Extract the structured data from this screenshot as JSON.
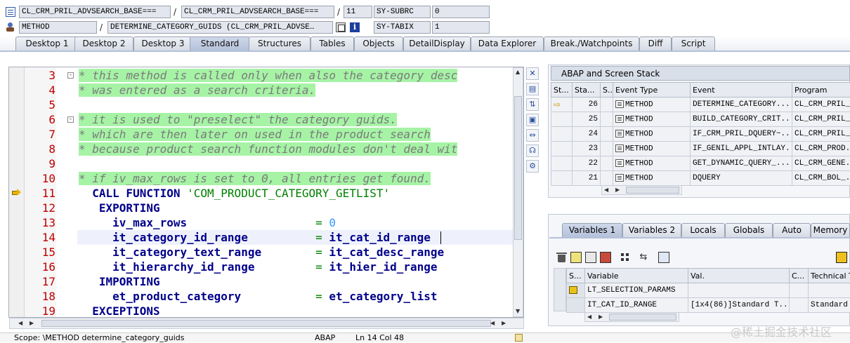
{
  "header": {
    "row1": {
      "program": "CL_CRM_PRIL_ADVSEARCH_BASE===",
      "include": "CL_CRM_PRIL_ADVSEARCH_BASE===",
      "line": "11",
      "sysvar_name": "SY-SUBRC",
      "sysvar_value": "0"
    },
    "row2": {
      "event_type": "METHOD",
      "event": "DETERMINE_CATEGORY_GUIDS (CL_CRM_PRIL_ADVSE…",
      "sysvar_name": "SY-TABIX",
      "sysvar_value": "1"
    },
    "separator": "/"
  },
  "tabs": [
    {
      "label": "Desktop 1"
    },
    {
      "label": "Desktop 2"
    },
    {
      "label": "Desktop 3"
    },
    {
      "label": "Standard",
      "active": true
    },
    {
      "label": "Structures"
    },
    {
      "label": "Tables"
    },
    {
      "label": "Objects"
    },
    {
      "label": "DetailDisplay"
    },
    {
      "label": "Data Explorer"
    },
    {
      "label": "Break./Watchpoints"
    },
    {
      "label": "Diff"
    },
    {
      "label": "Script"
    }
  ],
  "code": {
    "lines": [
      {
        "n": "3",
        "text": "* this method is called only when also the category desc",
        "type": "comment",
        "fold": "-"
      },
      {
        "n": "4",
        "text": "* was entered as a search criteria.",
        "type": "comment"
      },
      {
        "n": "5",
        "text": "",
        "type": "blank"
      },
      {
        "n": "6",
        "text": "* it is used to \"preselect\" the category guids.",
        "type": "comment",
        "fold": "-"
      },
      {
        "n": "7",
        "text": "* which are then later on used in the product search",
        "type": "comment"
      },
      {
        "n": "8",
        "text": "* because product search function modules don't deal wit",
        "type": "comment"
      },
      {
        "n": "9",
        "text": "",
        "type": "blank"
      },
      {
        "n": "10",
        "text": "* if iv_max_rows is set to 0, all entries get found.",
        "type": "comment"
      },
      {
        "n": "11",
        "kw": "  CALL FUNCTION ",
        "str": "'COM_PRODUCT_CATEGORY_GETLIST'",
        "type": "call"
      },
      {
        "n": "12",
        "kw": "   EXPORTING",
        "type": "kwline"
      },
      {
        "n": "13",
        "param": "     iv_max_rows                   ",
        "eq": "= ",
        "num": "0",
        "type": "assign_num"
      },
      {
        "n": "14",
        "param": "     it_category_id_range          ",
        "eq": "= ",
        "val": "it_cat_id_range",
        "type": "assign"
      },
      {
        "n": "15",
        "param": "     it_category_text_range        ",
        "eq": "= ",
        "val": "it_cat_desc_range",
        "type": "assign"
      },
      {
        "n": "16",
        "param": "     it_hierarchy_id_range         ",
        "eq": "= ",
        "val": "it_hier_id_range",
        "type": "assign"
      },
      {
        "n": "17",
        "kw": "   IMPORTING",
        "type": "kwline"
      },
      {
        "n": "18",
        "param": "     et_product_category           ",
        "eq": "= ",
        "val": "et_category_list",
        "type": "assign"
      },
      {
        "n": "19",
        "kw": "  EXCEPTIONS",
        "type": "kwline"
      }
    ]
  },
  "status": {
    "scope": "Scope: \\METHOD determine_category_guids",
    "language": "ABAP",
    "position": "Ln  14 Col  48"
  },
  "stack": {
    "title": "ABAP and Screen Stack",
    "columns": [
      "St...",
      "Sta...",
      "S...",
      "Event Type",
      "Event",
      "Program"
    ],
    "rows": [
      {
        "level": "26",
        "type": "METHOD",
        "event": "DETERMINE_CATEGORY...",
        "program": "CL_CRM_PRIL_...",
        "current": true
      },
      {
        "level": "25",
        "type": "METHOD",
        "event": "BUILD_CATEGORY_CRIT...",
        "program": "CL_CRM_PRIL_..."
      },
      {
        "level": "24",
        "type": "METHOD",
        "event": "IF_CRM_PRIL_DQUERY~...",
        "program": "CL_CRM_PRIL_..."
      },
      {
        "level": "23",
        "type": "METHOD",
        "event": "IF_GENIL_APPL_INTLAY...",
        "program": "CL_CRM_PROD..."
      },
      {
        "level": "22",
        "type": "METHOD",
        "event": "GET_DYNAMIC_QUERY_...",
        "program": "CL_CRM_GENE..."
      },
      {
        "level": "21",
        "type": "METHOD",
        "event": "DQUERY",
        "program": "CL_CRM_BOL_..."
      }
    ]
  },
  "var_tabs": [
    {
      "label": "Variables 1",
      "active": true
    },
    {
      "label": "Variables 2"
    },
    {
      "label": "Locals"
    },
    {
      "label": "Globals"
    },
    {
      "label": "Auto"
    },
    {
      "label": "Memory"
    }
  ],
  "variables": {
    "columns": [
      "S...",
      "Variable",
      "Val.",
      "C...",
      "Technical T"
    ],
    "rows": [
      {
        "variable": "LT_SELECTION_PARAMS",
        "value": "",
        "technical": ""
      },
      {
        "variable": "IT_CAT_ID_RANGE",
        "value": "[1x4(86)]Standard T...",
        "technical": "Standard Ta"
      }
    ]
  },
  "watermark": "@稀土掘金技术社区",
  "colors": {
    "comment_bg": "#a6f3a6",
    "keyword": "#00008b",
    "string": "#008000",
    "line_number": "#c00000",
    "tab_active": "#b4c1da"
  }
}
